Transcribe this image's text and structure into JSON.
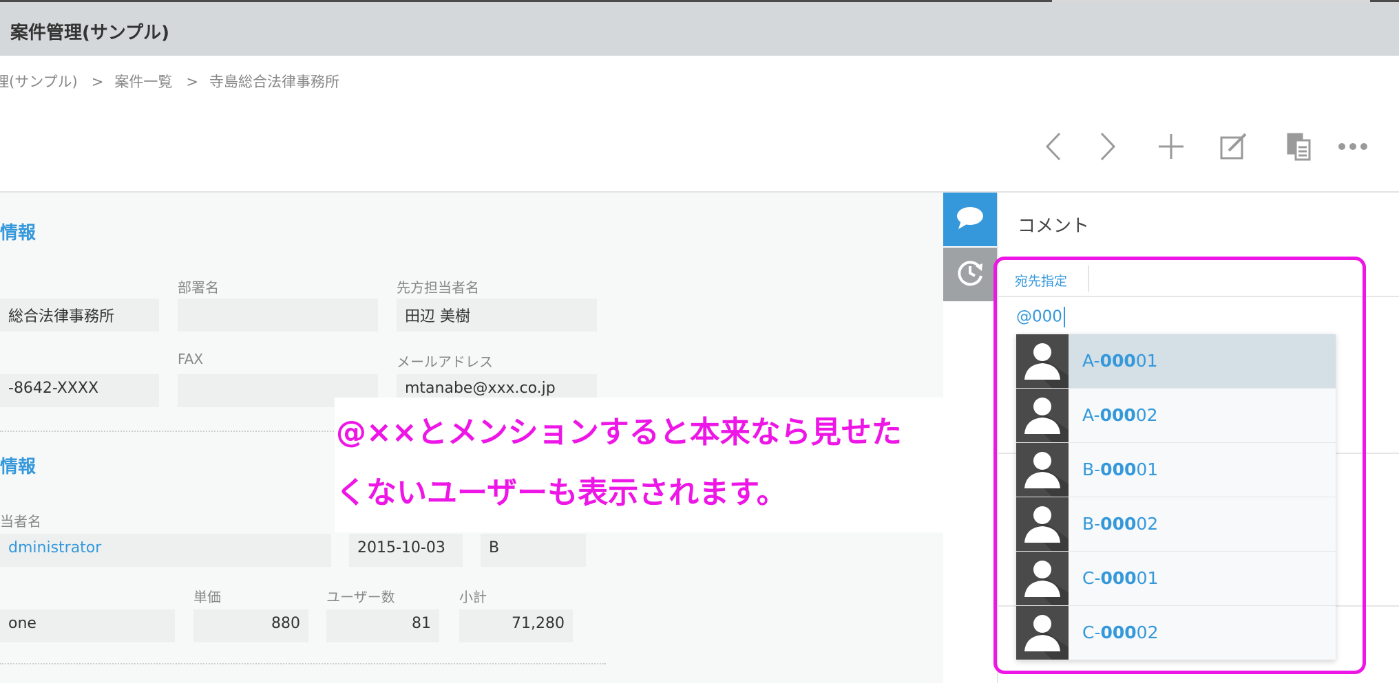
{
  "app": {
    "title": "案件管理(サンプル)"
  },
  "breadcrumb": {
    "items": [
      "理(サンプル)",
      "案件一覧",
      "寺島総合法律事務所"
    ],
    "separator": ">"
  },
  "toolbar": {
    "icons": [
      "chevron-left-icon",
      "chevron-right-icon",
      "plus-icon",
      "edit-icon",
      "copy-icon",
      "more-icon"
    ]
  },
  "record": {
    "section1": {
      "title": "情報",
      "company_value": "総合法律事務所",
      "dept_label": "部署名",
      "dept_value": "",
      "contact_label": "先方担当者名",
      "contact_value": "田辺 美樹",
      "phone_value": "-8642-XXXX",
      "fax_label": "FAX",
      "fax_value": "",
      "email_label": "メールアドレス",
      "email_value": "mtanabe@xxx.co.jp"
    },
    "section2": {
      "title": "情報",
      "owner_label": "当者名",
      "owner_value": "dministrator",
      "date_value": "2015-10-03",
      "rank_value": "B",
      "product_value": "one",
      "unit_price_label": "単価",
      "unit_price_value": "880",
      "users_label": "ユーザー数",
      "users_value": "81",
      "subtotal_label": "小計",
      "subtotal_value": "71,280"
    }
  },
  "annotation": {
    "line1": "@××とメンションすると本来なら見せた",
    "line2": "くないユーザーも表示されます。",
    "color": "#ee16e6"
  },
  "comments": {
    "tabs": [
      "comment-icon",
      "history-icon"
    ],
    "title": "コメント",
    "recipient_label": "宛先指定",
    "input_value": "@000",
    "suggestions": [
      {
        "prefix": "A-",
        "match": "000",
        "suffix": "01"
      },
      {
        "prefix": "A-",
        "match": "000",
        "suffix": "02"
      },
      {
        "prefix": "B-",
        "match": "000",
        "suffix": "01"
      },
      {
        "prefix": "B-",
        "match": "000",
        "suffix": "02"
      },
      {
        "prefix": "C-",
        "match": "000",
        "suffix": "01"
      },
      {
        "prefix": "C-",
        "match": "000",
        "suffix": "02"
      }
    ]
  },
  "colors": {
    "accent": "#3498db",
    "highlight": "#ee16e6",
    "header_bg": "#d5d8da"
  }
}
